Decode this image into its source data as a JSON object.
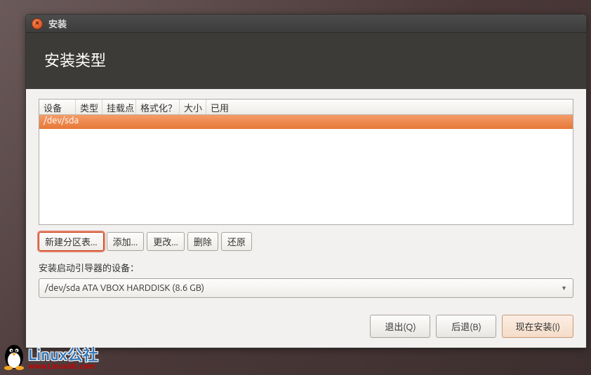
{
  "window": {
    "title": "安装"
  },
  "header": {
    "title": "安装类型"
  },
  "table": {
    "columns": [
      "设备",
      "类型",
      "挂载点",
      "格式化？",
      "大小",
      "已用"
    ],
    "rows": [
      {
        "device": "/dev/sda",
        "type": "",
        "mount": "",
        "format": "",
        "size": "",
        "used": "",
        "selected": true
      }
    ]
  },
  "buttons": {
    "new_table": "新建分区表...",
    "add": "添加...",
    "change": "更改...",
    "delete": "删除",
    "revert": "还原"
  },
  "bootloader": {
    "label": "安装启动引导器的设备：",
    "value": "/dev/sda  ATA VBOX HARDDISK (8.6 GB)"
  },
  "footer": {
    "quit": "退出(Q)",
    "back": "后退(B)",
    "install": "现在安装(I)"
  },
  "watermark": {
    "title": "Linux公社",
    "url": "www.Linuxidc.com"
  }
}
